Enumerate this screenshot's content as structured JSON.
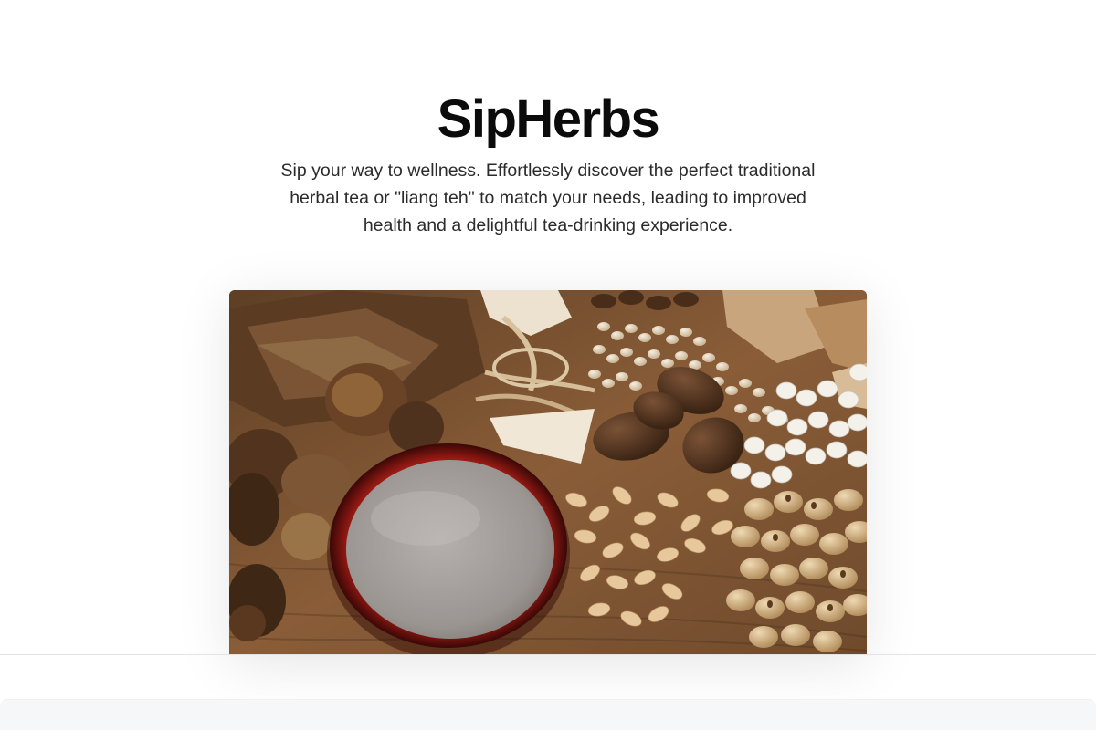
{
  "hero": {
    "title": "SipHerbs",
    "tagline": "Sip your way to wellness. Effortlessly discover the perfect traditional herbal tea or \"liang teh\" to match your needs, leading to improved health and a delightful tea-drinking experience."
  },
  "image": {
    "icon": "herbal-tea-ingredients-photo"
  },
  "colors": {
    "background": "#ffffff",
    "title": "#0b0b0b",
    "text": "#2b2b2b",
    "panel": "#f6f7f9"
  }
}
